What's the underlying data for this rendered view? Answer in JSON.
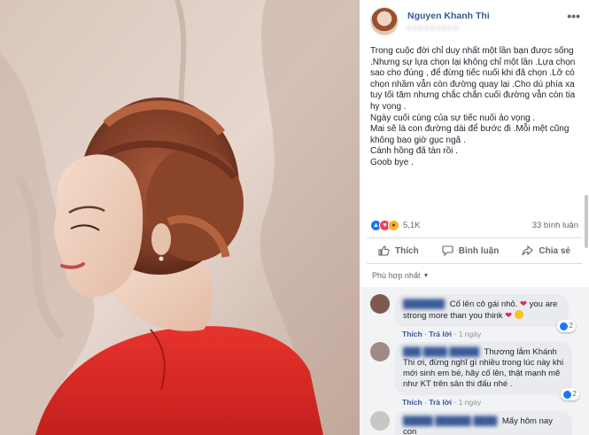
{
  "photo": {
    "alt": ""
  },
  "post": {
    "author": "Nguyen Khanh Thi",
    "meta": "• • • • • • • • •",
    "more": "•••",
    "lines": [
      "Trong cuộc đời chỉ duy nhất một lần bạn được sống",
      ".Nhưng sự lựa chọn lại không chỉ một lần .Lựa chọn",
      "sao cho đúng , để đừng tiếc nuối khi đã chọn .Lỡ có",
      "chọn nhầm vẫn còn đường quay lại .Cho dù phía xa",
      "tuy tối tăm nhưng chắc chắn cuối đường vẫn còn tia",
      "hy vọng .",
      "Ngày cuối cùng của sự tiếc nuối ảo vọng .",
      "Mai sẽ là con đường dài để bước đi .Mỗi mệt cũng",
      "không bao giờ gục ngã .",
      "Cánh hồng đã tàn rồi .",
      "Goob bye ."
    ],
    "reaction_count": "5,1K",
    "comment_count": "33 bình luận",
    "actions": {
      "like": "Thích",
      "comment": "Bình luận",
      "share": "Chia sẻ"
    },
    "sort_label": "Phù hợp nhất"
  },
  "comments": [
    {
      "name": "███████",
      "text_a": "Cố lên cô gái nhỏ.",
      "text_b": "you are strong more than you think",
      "reacts": "2",
      "like": "Thích",
      "reply": "Trả lời",
      "time": "1 ngày",
      "avatar_color": "#7d5a4f"
    },
    {
      "name": "███ ████ █████",
      "text": "Thương lắm Khánh Thi ơi, đừng nghĩ gì nhiều trong lúc này khi mới sinh em bé, hãy cố lên, thật mạnh mẽ như KT trên sân thi đấu nhé .",
      "reacts": "2",
      "like": "Thích",
      "reply": "Trả lời",
      "time": "1 ngày",
      "avatar_color": "#a08a86"
    },
    {
      "name": "█████ ██████ ████",
      "text": "Mấy hôm nay con",
      "avatar_color": "#c9c6c4"
    }
  ]
}
